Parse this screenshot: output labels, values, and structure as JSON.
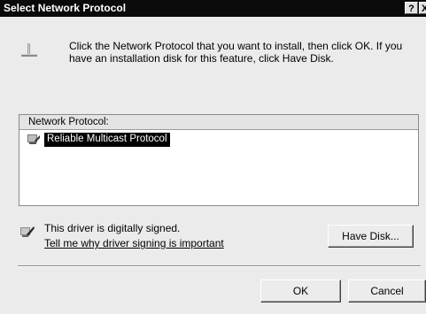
{
  "window": {
    "title": "Select Network Protocol",
    "help_label": "?",
    "close_label": "X"
  },
  "instruction": "Click the Network Protocol that you want to install, then click OK. If you have an installation disk for this feature, click Have Disk.",
  "list": {
    "header": "Network Protocol:",
    "items": [
      {
        "label": "Reliable Multicast Protocol",
        "selected": true
      }
    ]
  },
  "signing": {
    "status": "This driver is digitally signed.",
    "link": "Tell me why driver signing is important"
  },
  "buttons": {
    "have_disk": "Have Disk...",
    "ok": "OK",
    "cancel": "Cancel"
  },
  "colors": {
    "titlebar": "#0a0a0a",
    "dialog_bg": "#ebebeb",
    "selection_bg": "#000000"
  }
}
